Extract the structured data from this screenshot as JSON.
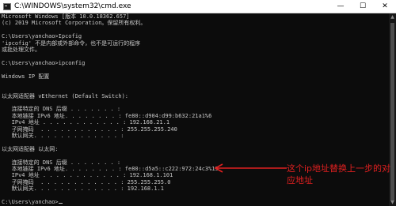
{
  "window": {
    "title": "C:\\WINDOWS\\system32\\cmd.exe",
    "controls": {
      "minimize": "—",
      "maximize": "☐",
      "close": "✕"
    }
  },
  "console": {
    "lines": [
      "Microsoft Windows [版本 10.0.18362.657]",
      "(c) 2019 Microsoft Corporation。保留所有权利。",
      "",
      "C:\\Users\\yanchao>Ipcofig",
      "'ipcofig' 不是内部或外部命令，也不是可运行的程序",
      "或批处理文件。",
      "",
      "C:\\Users\\yanchao>ipconfig",
      "",
      "Windows IP 配置",
      "",
      "",
      "以太网适配器 vEthernet (Default Switch):",
      "",
      "   连接特定的 DNS 后缀 . . . . . . . :",
      "   本地链接 IPv6 地址. . . . . . . . : fe80::d904:d99:b632:21a1%6",
      "   IPv4 地址 . . . . . . . . . . . . : 192.168.21.1",
      "   子网掩码  . . . . . . . . . . . . : 255.255.255.240",
      "   默认网关. . . . . . . . . . . . . :",
      "",
      "以太网适配器 以太网:",
      "",
      "   连接特定的 DNS 后缀 . . . . . . . :",
      "   本地链接 IPv6 地址. . . . . . . . : fe80::d5a5::c222:972:24c3%15",
      "   IPv4 地址 . . . . . . . . . . . . : 192.168.1.101",
      "   子网掩码  . . . . . . . . . . . . : 255.255.255.0",
      "   默认网关. . . . . . . . . . . . . : 192.168.1.1",
      "",
      "C:\\Users\\yanchao>"
    ]
  },
  "annotation": {
    "text": "这个ip地址替换上一步的对\n应地址",
    "color": "#e02020"
  },
  "scrollbar": {
    "up_arrow": "▲",
    "down_arrow": "▼"
  }
}
